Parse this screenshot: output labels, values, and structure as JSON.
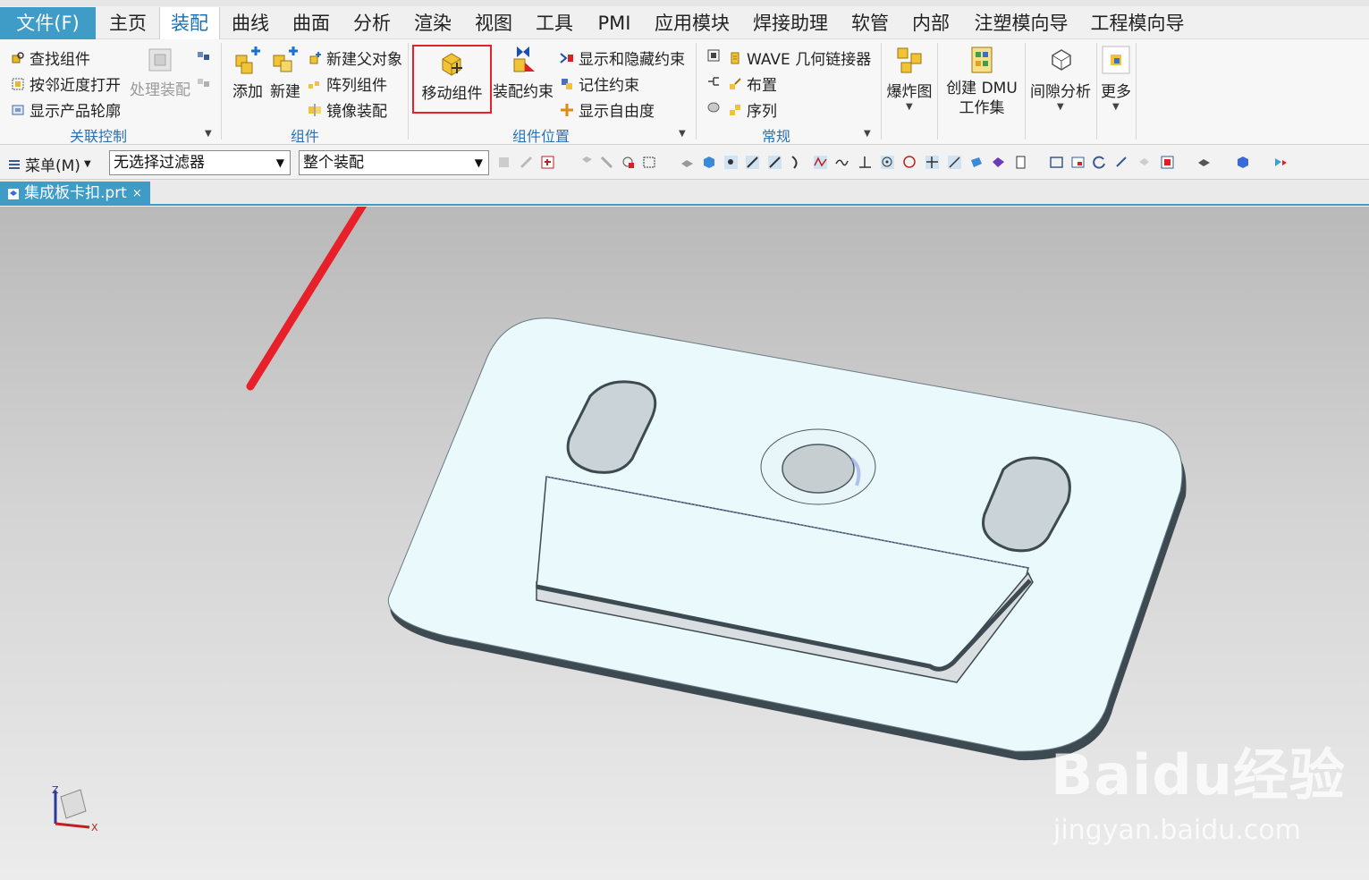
{
  "menubar": {
    "file": "文件(F)",
    "tabs": [
      "主页",
      "装配",
      "曲线",
      "曲面",
      "分析",
      "渲染",
      "视图",
      "工具",
      "PMI",
      "应用模块",
      "焊接助理",
      "软管",
      "内部",
      "注塑模向导",
      "工程模向导"
    ],
    "active_tab": "装配"
  },
  "ribbon": {
    "group1": {
      "items": [
        "查找组件",
        "按邻近度打开",
        "显示产品轮廓"
      ],
      "disabled_button": "处理装配",
      "label": "关联控制"
    },
    "group2": {
      "add": "添加",
      "new": "新建",
      "items": [
        "新建父对象",
        "阵列组件",
        "镜像装配"
      ],
      "label": "组件"
    },
    "group3": {
      "move_component": "移动组件",
      "assembly_constraint": "装配约束",
      "items": [
        "显示和隐藏约束",
        "记住约束",
        "显示自由度"
      ],
      "label": "组件位置"
    },
    "group4": {
      "items": [
        "WAVE 几何链接器",
        "布置",
        "序列"
      ],
      "label": "常规"
    },
    "explode": "爆炸图",
    "dmu_line1": "创建 DMU",
    "dmu_line2": "工作集",
    "clearance": "间隙分析",
    "more": "更多"
  },
  "toolbar": {
    "menu": "菜单(M)",
    "filter": "无选择过滤器",
    "scope": "整个装配"
  },
  "doc_tab": {
    "title": "集成板卡扣.prt",
    "close": "×"
  },
  "viewport": {
    "axis_z": "Z",
    "axis_x": "X",
    "watermark": "Baidu经验",
    "watermark_url": "jingyan.baidu.com"
  },
  "colors": {
    "accent": "#3f9cc7",
    "highlight_box": "#e8202a",
    "arrow": "#e8202a",
    "part_fill": "#eaf9fb"
  }
}
